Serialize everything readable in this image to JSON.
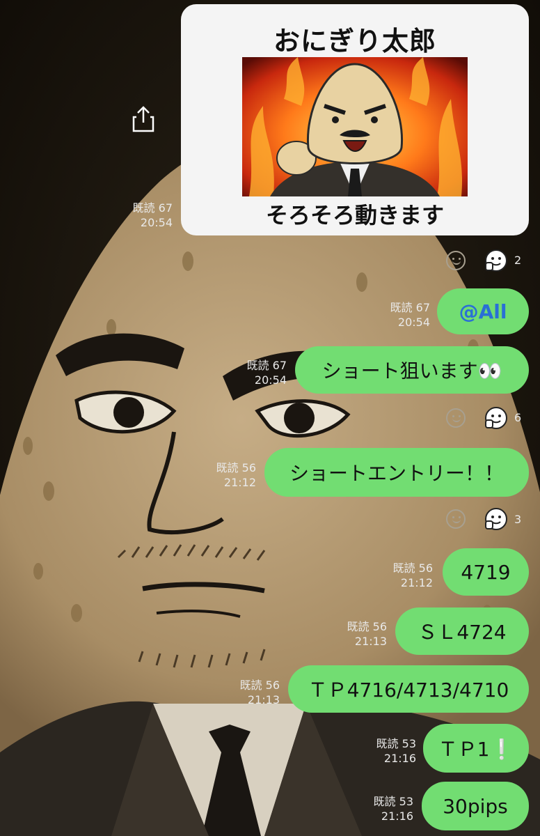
{
  "sticker": {
    "title": "おにぎり太郎",
    "caption": "そろそろ動きます"
  },
  "messages": [
    {
      "read": "既読 67",
      "time": "20:54"
    },
    {
      "read": "既読 67",
      "time": "20:54",
      "text": "@All"
    },
    {
      "read": "既読 67",
      "time": "20:54",
      "text": "ショート狙います👀"
    },
    {
      "read": "既読 56",
      "time": "21:12",
      "text": "ショートエントリー！！"
    },
    {
      "read": "既読 56",
      "time": "21:12",
      "text": "4719"
    },
    {
      "read": "既読 56",
      "time": "21:13",
      "text": "ＳＬ4724"
    },
    {
      "read": "既読 56",
      "time": "21:13",
      "text": "ＴＰ4716/4713/4710"
    },
    {
      "read": "既読 53",
      "time": "21:16",
      "text": "ＴＰ1❕"
    },
    {
      "read": "既読 53",
      "time": "21:16",
      "text": "30pips"
    }
  ],
  "reactions": [
    {
      "count": "2"
    },
    {
      "count": "6"
    },
    {
      "count": "3"
    }
  ],
  "colors": {
    "bubble": "#72dd72",
    "mention": "#2a6fd6",
    "background": "#1b160e"
  }
}
